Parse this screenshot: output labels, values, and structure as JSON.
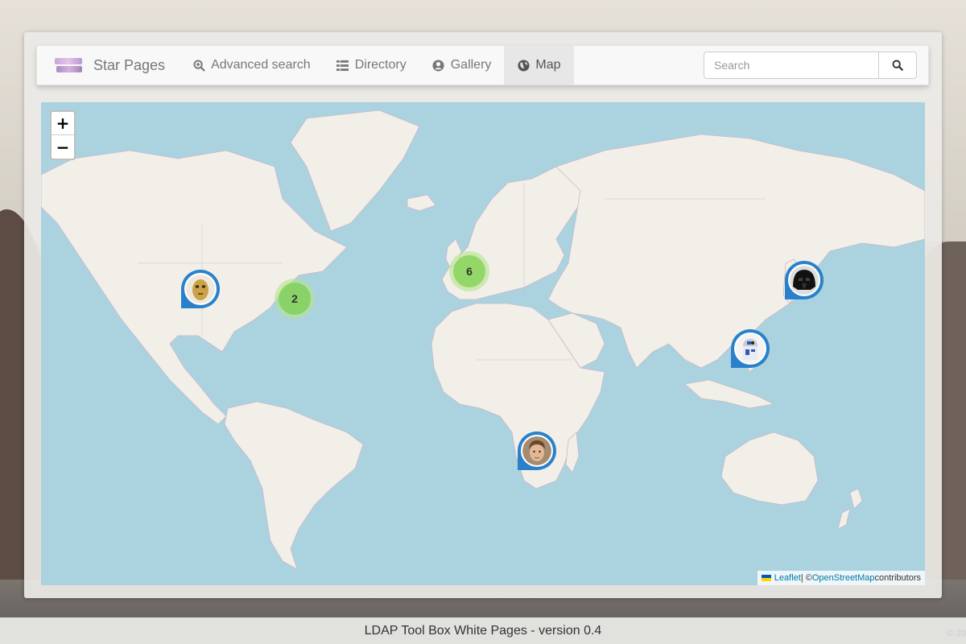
{
  "brand": {
    "name": "Star Pages"
  },
  "nav": [
    {
      "label": "Advanced search",
      "icon": "search-plus-icon",
      "active": false
    },
    {
      "label": "Directory",
      "icon": "list-icon",
      "active": false
    },
    {
      "label": "Gallery",
      "icon": "user-circle-icon",
      "active": false
    },
    {
      "label": "Map",
      "icon": "globe-icon",
      "active": true
    }
  ],
  "search": {
    "placeholder": "Search",
    "value": ""
  },
  "map": {
    "zoom_in": "+",
    "zoom_out": "−",
    "clusters": [
      {
        "count": "2",
        "region": "eastern-us"
      },
      {
        "count": "6",
        "region": "western-europe"
      }
    ],
    "markers": [
      {
        "name": "c3po",
        "region": "western-us"
      },
      {
        "name": "darth-vader",
        "region": "japan"
      },
      {
        "name": "r2d2",
        "region": "philippines"
      },
      {
        "name": "luke-skywalker",
        "region": "southern-africa"
      }
    ],
    "attribution": {
      "leaflet": "Leaflet",
      "separator": " | © ",
      "osm": "OpenStreetMap",
      "suffix": " contributors"
    }
  },
  "footer": {
    "text": "LDAP Tool Box White Pages - version 0.4",
    "corner": "© 20"
  },
  "colors": {
    "marker": "#2a81cb",
    "cluster": "#6ecc39",
    "sea": "#aad3df",
    "land": "#f2efe9"
  }
}
